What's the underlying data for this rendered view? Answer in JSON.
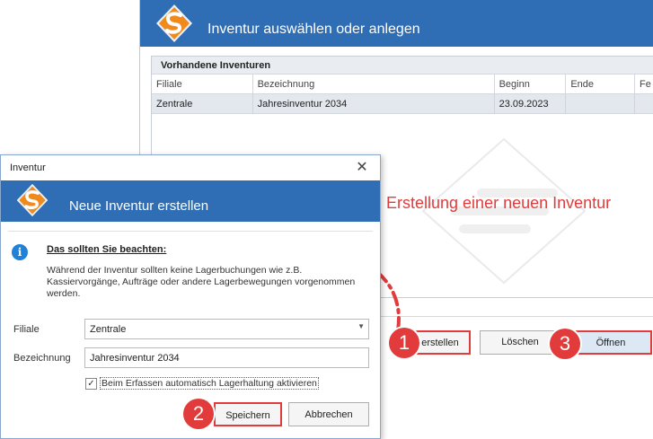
{
  "background_window": {
    "title": "Inventur auswählen oder anlegen",
    "group_label": "Vorhandene Inventuren",
    "columns": [
      "Filiale",
      "Bezeichnung",
      "Beginn",
      "Ende",
      "Fe"
    ],
    "rows": [
      [
        "Zentrale",
        "Jahresinventur 2034",
        "23.09.2023",
        "",
        ""
      ]
    ],
    "buttons": {
      "create": "erstellen",
      "delete": "Löschen",
      "open": "Öffnen"
    }
  },
  "annotation": {
    "caption": "Erstellung einer neuen Inventur",
    "badges": [
      "1",
      "2",
      "3"
    ],
    "color": "#e23b3b"
  },
  "dialog": {
    "window_title": "Inventur",
    "close_glyph": "✕",
    "heading": "Neue Inventur erstellen",
    "info_icon": "i",
    "info_title": "Das sollten Sie beachten:",
    "info_text": "Während der Inventur sollten keine Lagerbuchungen wie z.B. Kassiervorgänge, Aufträge oder andere Lagerbewegungen vorgenommen werden.",
    "fields": {
      "filiale_label": "Filiale",
      "filiale_value": "Zentrale",
      "bezeichnung_label": "Bezeichnung",
      "bezeichnung_value": "Jahresinventur 2034"
    },
    "checkbox": {
      "label": "Beim Erfassen automatisch Lagerhaltung aktivieren",
      "checked_glyph": "✓"
    },
    "buttons": {
      "save": "Speichern",
      "cancel": "Abbrechen"
    }
  },
  "colors": {
    "header_blue": "#2f6db4",
    "logo_orange": "#f08a1c",
    "selected_row": "#e3e7ee"
  },
  "icons": [
    "app-logo-icon",
    "info-icon",
    "close-icon",
    "dropdown-arrow-icon",
    "checkbox-check-icon"
  ]
}
